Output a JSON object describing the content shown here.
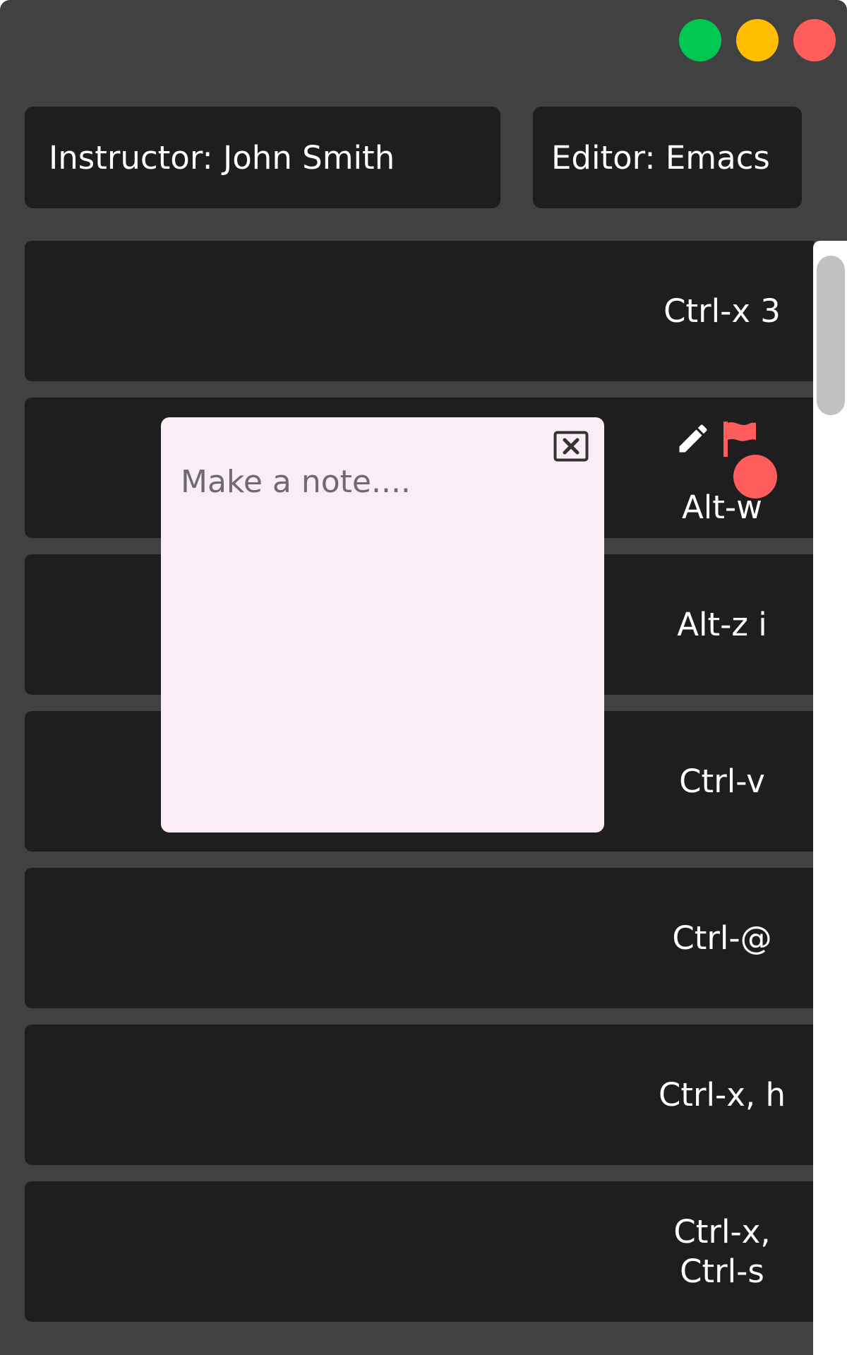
{
  "header": {
    "instructor": "Instructor: John Smith",
    "editor": "Editor: Emacs"
  },
  "colors": {
    "window_bg": "#414141",
    "card_bg": "#1e1e1e",
    "traffic_green": "#00c853",
    "traffic_yellow": "#ffbf00",
    "traffic_red": "#ff5c5c",
    "flag_red": "#ff5c5c",
    "note_bg": "#faedf6"
  },
  "shortcuts": [
    {
      "key": "Ctrl-x 3"
    },
    {
      "key": "Alt-w"
    },
    {
      "key": "Alt-z i"
    },
    {
      "key": "Ctrl-v"
    },
    {
      "key": "Ctrl-@"
    },
    {
      "key": "Ctrl-x, h"
    },
    {
      "key": "Ctrl-x, Ctrl-s"
    }
  ],
  "card_actions": {
    "edit_icon": "pencil-icon",
    "flag_icon": "flag-icon"
  },
  "note": {
    "placeholder": "Make a note....",
    "close_icon": "close-box-icon"
  }
}
